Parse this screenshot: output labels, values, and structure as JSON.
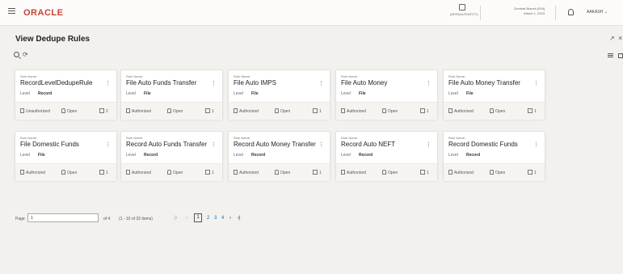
{
  "header": {
    "brand": "ORACLE",
    "branch_label": "(DEFAULTENTITY)",
    "branch_name": "Dumbai Branch  [004]",
    "branch_date": "March 1, 2023",
    "user": "AAKASH"
  },
  "page": {
    "title": "View Dedupe Rules"
  },
  "card_labels": {
    "rule_name": "Rule Name:",
    "level": "Level",
    "open": "Open"
  },
  "cards": [
    {
      "name": "RecordLevelDedupeRule",
      "level": "Record",
      "status": "Unauthorized",
      "version": "2"
    },
    {
      "name": "File Auto Funds Transfer",
      "level": "File",
      "status": "Authorized",
      "version": "1"
    },
    {
      "name": "File Auto IMPS",
      "level": "File",
      "status": "Authorized",
      "version": "1"
    },
    {
      "name": "File Auto Money",
      "level": "File",
      "status": "Authorized",
      "version": "1"
    },
    {
      "name": "File Auto Money Transfer",
      "level": "File",
      "status": "Authorized",
      "version": "1"
    },
    {
      "name": "File Domestic Funds",
      "level": "File",
      "status": "Authorized",
      "version": "1"
    },
    {
      "name": "Record Auto Funds Transfer",
      "level": "Record",
      "status": "Authorized",
      "version": "1"
    },
    {
      "name": "Record Auto Money Transfer",
      "level": "Record",
      "status": "Authorized",
      "version": "1"
    },
    {
      "name": "Record Auto NEFT",
      "level": "Record",
      "status": "Authorized",
      "version": "1"
    },
    {
      "name": "Record Domestic Funds",
      "level": "Record",
      "status": "Authorized",
      "version": "1"
    }
  ],
  "pagination": {
    "label": "Page",
    "value": "1",
    "of": "of 4",
    "items": "(1 - 10 of 32 items)",
    "first": "|‹",
    "prev": "‹",
    "current": "1",
    "pages": [
      "2",
      "3",
      "4"
    ],
    "next": "›",
    "last": "›|"
  },
  "colors": {
    "brand": "#c74634",
    "link": "#1a6ec1",
    "background": "#f3f1ee"
  }
}
